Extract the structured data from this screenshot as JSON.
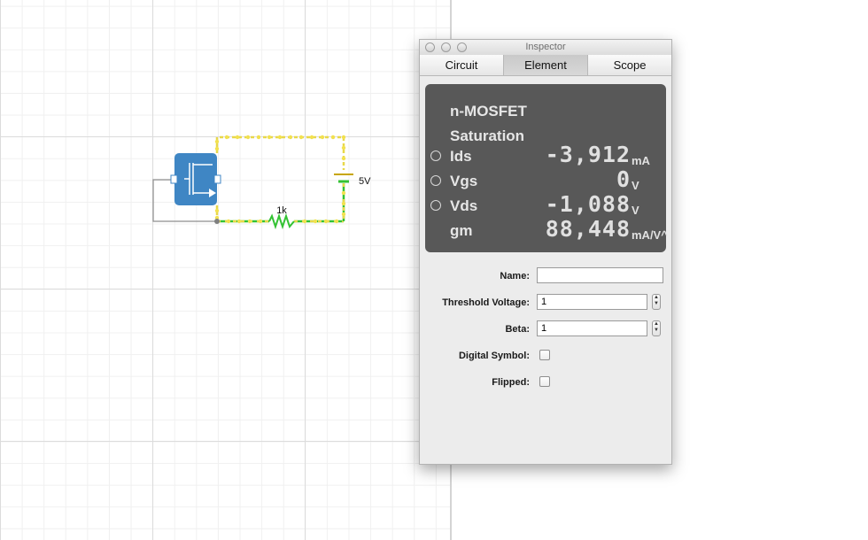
{
  "circuit": {
    "resistor_label": "1k",
    "source_label": "5V"
  },
  "inspector": {
    "title": "Inspector",
    "tabs": [
      {
        "label": "Circuit",
        "active": false
      },
      {
        "label": "Element",
        "active": true
      },
      {
        "label": "Scope",
        "active": false
      }
    ],
    "display": {
      "device": "n-MOSFET",
      "region": "Saturation",
      "readouts": [
        {
          "label": "Ids",
          "value": "-3,912",
          "unit": "mA",
          "selectable": true
        },
        {
          "label": "Vgs",
          "value": "0",
          "unit": "V",
          "selectable": true
        },
        {
          "label": "Vds",
          "value": "-1,088",
          "unit": "V",
          "selectable": true
        },
        {
          "label": "gm",
          "value": "88,448",
          "unit": "mA/V^",
          "selectable": false
        }
      ]
    },
    "fields": {
      "name_label": "Name:",
      "name_value": "",
      "threshold_label": "Threshold Voltage:",
      "threshold_value": "1",
      "beta_label": "Beta:",
      "beta_value": "1",
      "digital_label": "Digital Symbol:",
      "digital_checked": false,
      "flipped_label": "Flipped:",
      "flipped_checked": false
    }
  },
  "colors": {
    "wire_current": "#e8d84a",
    "wire_ground": "#33c233",
    "mosfet_fill": "#3f86c4",
    "display_bg": "#585858"
  }
}
